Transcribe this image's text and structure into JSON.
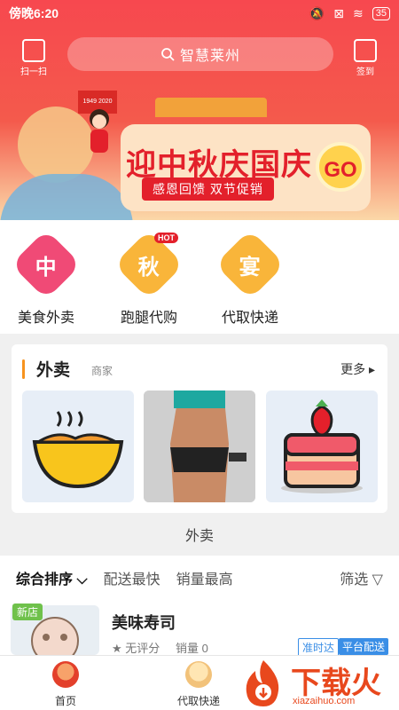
{
  "status_bar": {
    "time": "傍晚6:20",
    "battery": "35"
  },
  "header": {
    "scan_label": "扫一扫",
    "search_placeholder": "智慧莱州",
    "signin_label": "签到"
  },
  "banner": {
    "flag_text": "1949 2020",
    "headline": "迎中秋庆国庆",
    "subline": "感恩回馈 双节促销",
    "go_label": "GO"
  },
  "categories": [
    {
      "glyph": "中",
      "label": "美食外卖",
      "color": "#f04a76"
    },
    {
      "glyph": "秋",
      "label": "跑腿代购",
      "color": "#f9b53a",
      "badge": "HOT"
    },
    {
      "glyph": "宴",
      "label": "代取快递",
      "color": "#f9b53a"
    }
  ],
  "takeout_card": {
    "title": "外卖",
    "subtitle": "商家",
    "more_label": "更多 ▸",
    "caption": "外卖"
  },
  "sort_bar": {
    "items": [
      "综合排序 ⌵",
      "配送最快",
      "销量最高"
    ],
    "filter_label": "筛选 ▽"
  },
  "shop": {
    "badge": "新店",
    "name": "美味寿司",
    "rating": "★ 无评分",
    "sales": "销量 0",
    "tag_ontime": "准时达",
    "tag_platform": "平台配送"
  },
  "bottom_nav": {
    "home_label": "首页",
    "express_label": "代取快递"
  },
  "watermark": {
    "text": "下载火",
    "url": "xiazaihuo.com"
  },
  "colors": {
    "brand_red": "#f7484f",
    "accent_orange": "#f7931e",
    "tag_blue": "#3a8ee6"
  }
}
